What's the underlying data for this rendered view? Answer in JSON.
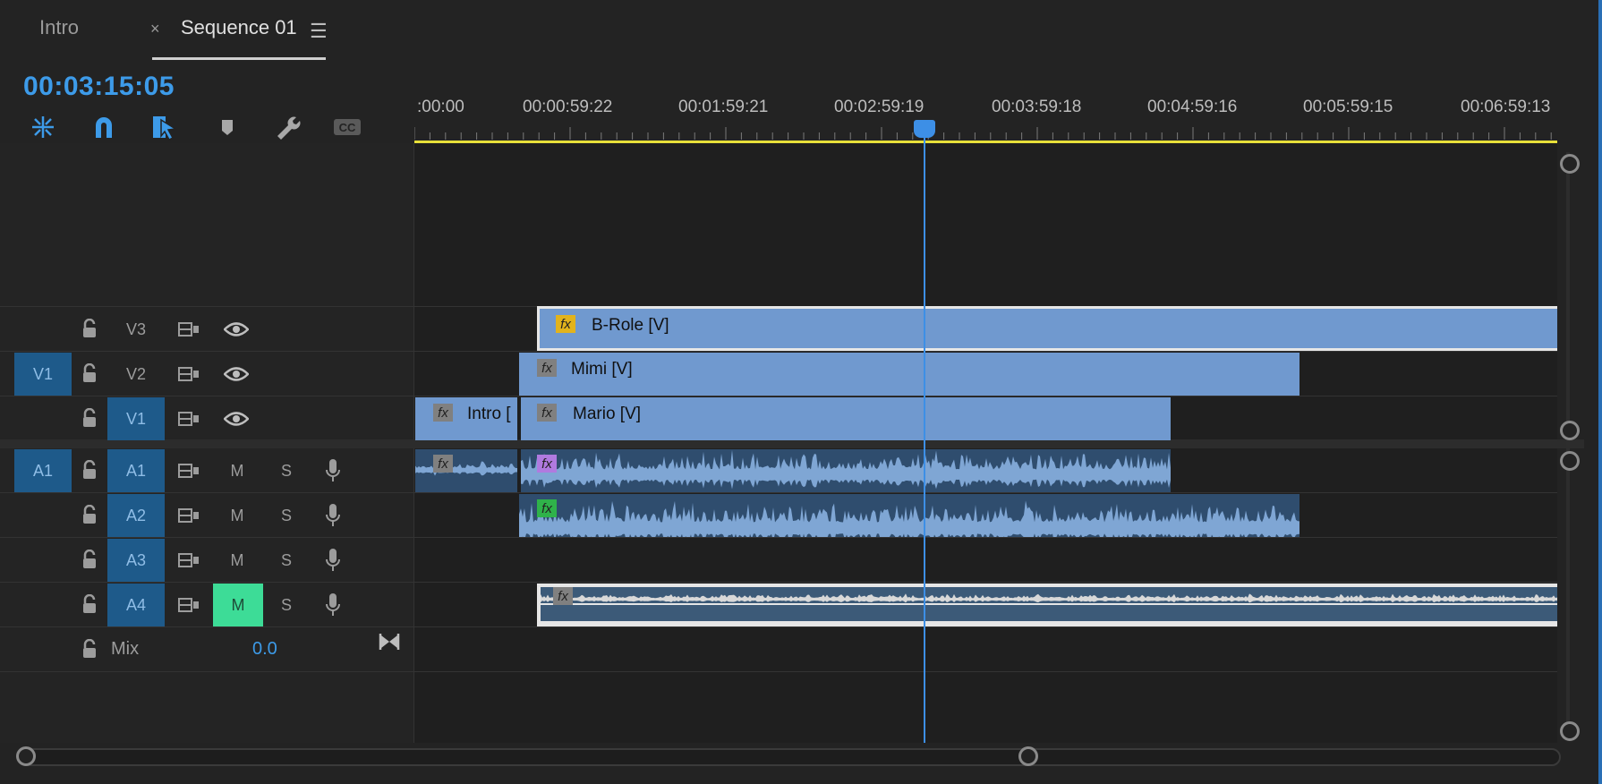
{
  "tabs": [
    {
      "label": "Intro"
    },
    {
      "label": "Sequence 01"
    }
  ],
  "timecode": "00:03:15:05",
  "ruler_labels": [
    ":00:00",
    "00:00:59:22",
    "00:01:59:21",
    "00:02:59:19",
    "00:03:59:18",
    "00:04:59:16",
    "00:05:59:15",
    "00:06:59:13"
  ],
  "video_tracks": [
    {
      "name": "V3",
      "source": ""
    },
    {
      "name": "V2",
      "source": "V1"
    },
    {
      "name": "V1",
      "source": ""
    }
  ],
  "audio_tracks": [
    {
      "name": "A1",
      "source": "A1",
      "m": "M",
      "s": "S",
      "muted": false
    },
    {
      "name": "A2",
      "source": "",
      "m": "M",
      "s": "S",
      "muted": false
    },
    {
      "name": "A3",
      "source": "",
      "m": "M",
      "s": "S",
      "muted": false
    },
    {
      "name": "A4",
      "source": "",
      "m": "M",
      "s": "S",
      "muted": true
    }
  ],
  "mix": {
    "label": "Mix",
    "value": "0.0"
  },
  "clips": {
    "brole": "B-Role [V]",
    "mimi": "Mimi [V]",
    "intro": "Intro [",
    "mario": "Mario [V]",
    "fx": "fx"
  },
  "colors": {
    "accent": "#3d9be9",
    "clip": "#7099cf",
    "inout_bar": "#e8e03a",
    "mute_on": "#3ddc97",
    "fx_yellow": "#e2b31c",
    "fx_purple": "#b07adf",
    "fx_green": "#2fb24a"
  }
}
